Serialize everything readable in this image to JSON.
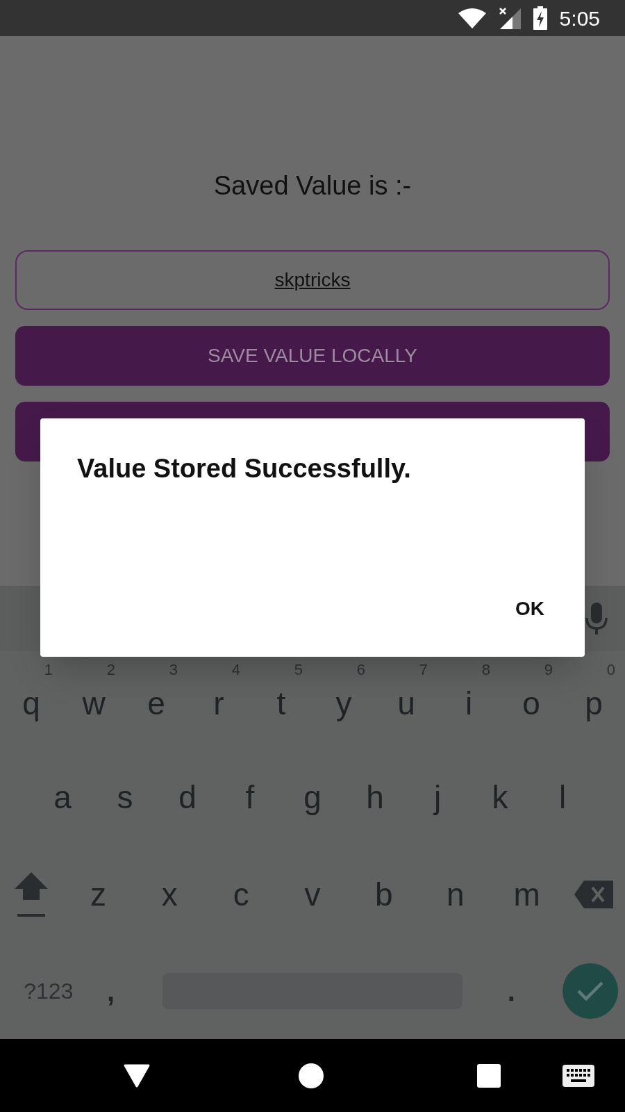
{
  "status_bar": {
    "time": "5:05"
  },
  "screen": {
    "title": "Saved Value is :-",
    "field": {
      "value": "skptricks"
    },
    "buttons": [
      {
        "kind": "text",
        "label": "SAVE VALUE LOCALLY"
      },
      {
        "kind": "covered"
      }
    ]
  },
  "dialog": {
    "message": "Value Stored Successfully.",
    "buttons": [
      "OK"
    ]
  },
  "keyboard": {
    "rows": [
      [
        {
          "label": "q",
          "hint": "1"
        },
        {
          "label": "w",
          "hint": "2"
        },
        {
          "label": "e",
          "hint": "3"
        },
        {
          "label": "r",
          "hint": "4"
        },
        {
          "label": "t",
          "hint": "5"
        },
        {
          "label": "y",
          "hint": "6"
        },
        {
          "label": "u",
          "hint": "7"
        },
        {
          "label": "i",
          "hint": "8"
        },
        {
          "label": "o",
          "hint": "9"
        },
        {
          "label": "p",
          "hint": "0"
        }
      ],
      [
        {
          "label": "a"
        },
        {
          "label": "s"
        },
        {
          "label": "d"
        },
        {
          "label": "f"
        },
        {
          "label": "g"
        },
        {
          "label": "h"
        },
        {
          "label": "j"
        },
        {
          "label": "k"
        },
        {
          "label": "l"
        }
      ],
      [
        {
          "label": "z"
        },
        {
          "label": "x"
        },
        {
          "label": "c"
        },
        {
          "label": "v"
        },
        {
          "label": "b"
        },
        {
          "label": "n"
        },
        {
          "label": "m"
        }
      ]
    ],
    "symbols_key": "?123",
    "comma": ",",
    "period": "."
  }
}
